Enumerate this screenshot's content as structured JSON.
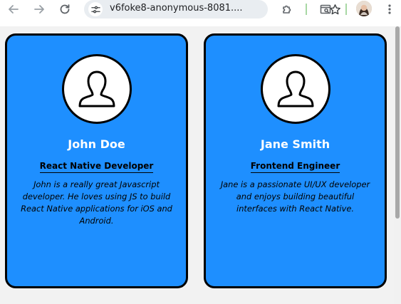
{
  "browser": {
    "url": "v6foke8-anonymous-8081....",
    "icons": {
      "back": "arrow-left-icon",
      "forward": "arrow-right-icon",
      "reload": "reload-icon",
      "site_info": "tune-icon",
      "bookmark": "star-icon",
      "extensions": "puzzle-icon",
      "side_panel": "side-panel-search-icon",
      "menu": "kebab-menu-icon"
    }
  },
  "cards": [
    {
      "name": "John Doe",
      "role": "React Native Developer",
      "bio": "John is a really great Javascript developer. He loves using JS to build React Native applications for iOS and Android."
    },
    {
      "name": "Jane Smith",
      "role": "Frontend Engineer",
      "bio": "Jane is a passionate UI/UX developer and enjoys building beautiful interfaces with React Native."
    }
  ],
  "colors": {
    "card_background": "#1e8fff",
    "card_border": "#000000",
    "name_text": "#ffffff",
    "page_background": "#f2f2f2"
  }
}
